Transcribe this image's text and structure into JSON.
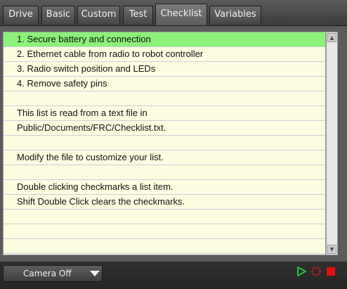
{
  "tabs": [
    {
      "label": "Drive"
    },
    {
      "label": "Basic"
    },
    {
      "label": "Custom"
    },
    {
      "label": "Test"
    },
    {
      "label": "Checklist"
    },
    {
      "label": "Variables"
    }
  ],
  "active_tab": "Checklist",
  "checklist": {
    "items": [
      "1. Secure battery and connection",
      "2. Ethernet cable from radio to robot controller",
      "3. Radio switch position and LEDs",
      "4. Remove safety pins",
      "",
      "This list is read from a text file in",
      "Public/Documents/FRC/Checklist.txt.",
      "",
      "Modify the file to customize your list.",
      "",
      "Double clicking checkmarks a list item.",
      "Shift Double Click clears the checkmarks.",
      "",
      "",
      "",
      ""
    ],
    "selected_index": 0,
    "colors": {
      "background": "#fdfde0",
      "selected": "#8cf07a"
    }
  },
  "status": {
    "camera_select_value": "Camera Off",
    "icons": [
      "play-icon",
      "loading-spinner-icon",
      "stop-icon"
    ],
    "colors": {
      "play": "#27c43a",
      "spinner": "#e02020",
      "stop": "#e01010"
    }
  }
}
